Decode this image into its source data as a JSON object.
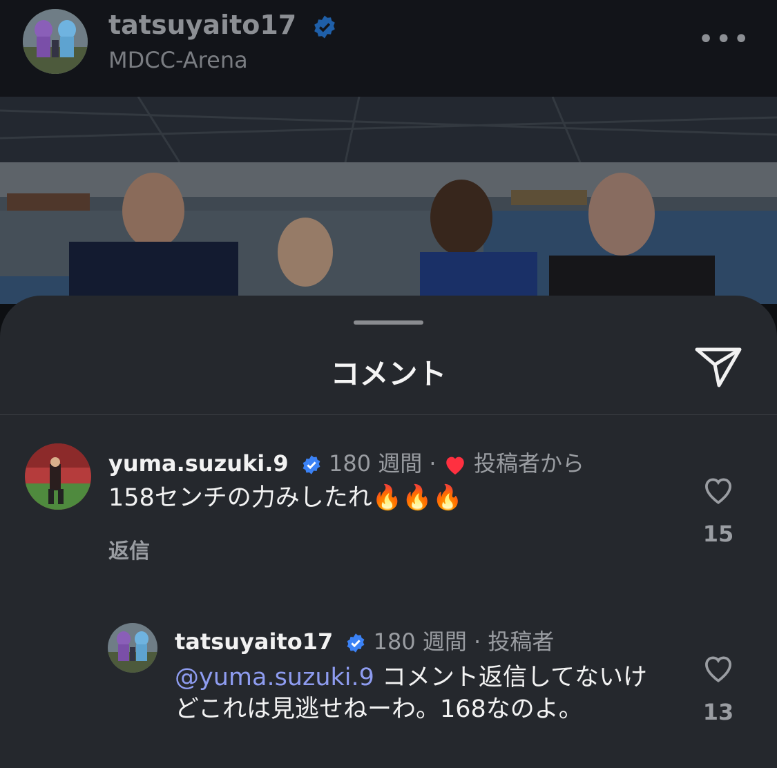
{
  "post": {
    "username": "tatsuyaito17",
    "location": "MDCC-Arena",
    "more_label": "•••"
  },
  "sheet": {
    "title": "コメント"
  },
  "comments": [
    {
      "username": "yuma.suzuki.9",
      "time": "180 週間",
      "separator": " · ",
      "from_author": "投稿者から",
      "text": "158センチの力みしたれ🔥🔥🔥",
      "reply_label": "返信",
      "likes": "15"
    },
    {
      "username": "tatsuyaito17",
      "time": "180 週間",
      "separator": " · ",
      "author_tag": "投稿者",
      "mention": "@yuma.suzuki.9",
      "text": " コメント返信してないけどこれは見逃せねーわ。168なのよ。",
      "likes": "13"
    }
  ],
  "colors": {
    "verified": "#3b82f6",
    "heart": "#ff3040",
    "mention": "#8e9cf0",
    "sheet_bg": "#25282d"
  }
}
